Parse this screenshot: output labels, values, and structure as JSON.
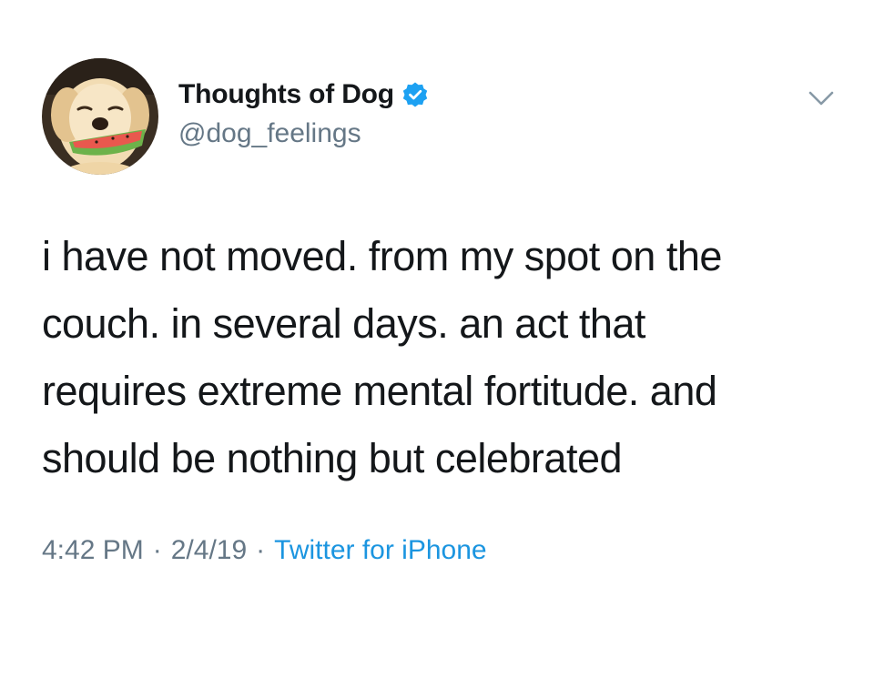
{
  "tweet": {
    "author": {
      "display_name": "Thoughts of Dog",
      "handle": "@dog_feelings",
      "verified": true,
      "avatar_icon": "dog-with-watermelon-avatar"
    },
    "text_lines": [
      "i have not moved. from my spot on the",
      "couch. in several days. an act that",
      "requires extreme mental fortitude. and",
      "should be nothing but celebrated"
    ],
    "time": "4:42 PM",
    "date": "2/4/19",
    "separator": "·",
    "source": "Twitter for iPhone",
    "menu_icon": "chevron-down-icon"
  },
  "colors": {
    "text": "#14171a",
    "secondary": "#657786",
    "accent": "#1b95e0",
    "verified_badge": "#1da1f2",
    "background": "#ffffff"
  }
}
